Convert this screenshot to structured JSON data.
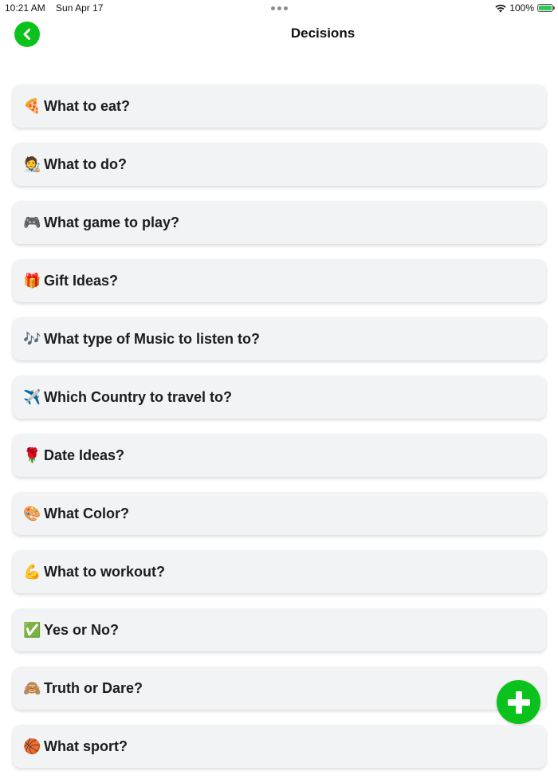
{
  "status_bar": {
    "time": "10:21 AM",
    "date": "Sun Apr 17",
    "battery": "100%"
  },
  "header": {
    "title": "Decisions",
    "back_icon": "chevron-left-icon"
  },
  "colors": {
    "accent": "#0bc21c",
    "card_bg": "#f2f3f5"
  },
  "items": [
    {
      "emoji": "🍕",
      "label": "What to eat?"
    },
    {
      "emoji": "🧑‍🎨",
      "label": "What to do?"
    },
    {
      "emoji": "🎮",
      "label": "What game to play?"
    },
    {
      "emoji": "🎁",
      "label": "Gift Ideas?"
    },
    {
      "emoji": "🎶",
      "label": "What type of Music to listen to?"
    },
    {
      "emoji": "✈️",
      "label": "Which Country to travel to?"
    },
    {
      "emoji": "🌹",
      "label": "Date Ideas?"
    },
    {
      "emoji": "🎨",
      "label": "What Color?"
    },
    {
      "emoji": "💪",
      "label": "What to workout?"
    },
    {
      "emoji": "✅",
      "label": "Yes or No?"
    },
    {
      "emoji": "🙈",
      "label": "Truth or Dare?"
    },
    {
      "emoji": "🏀",
      "label": "What sport?"
    }
  ],
  "add_icon": "plus-icon"
}
